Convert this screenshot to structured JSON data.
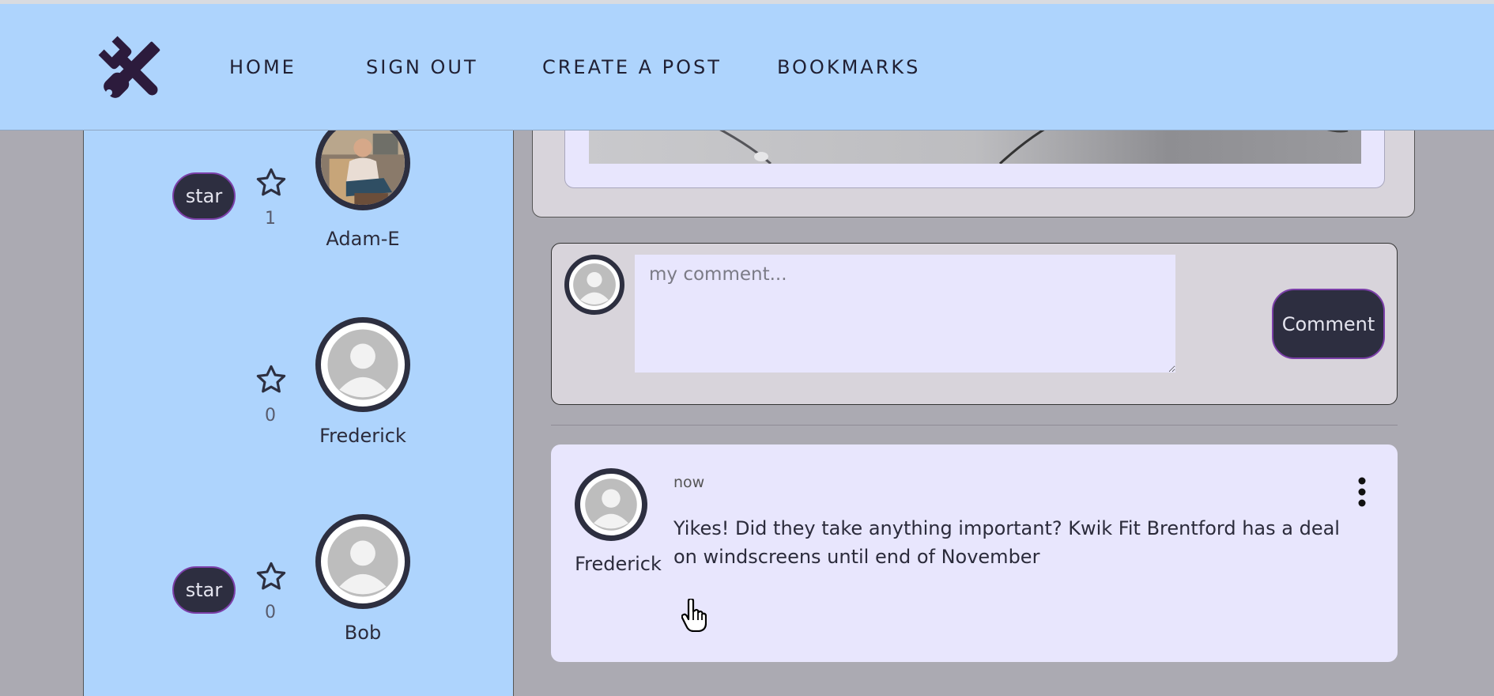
{
  "navbar": {
    "logo_icon": "tools-icon",
    "links": [
      "HOME",
      "SIGN OUT",
      "CREATE A POST",
      "BOOKMARKS"
    ]
  },
  "sidebar": {
    "profiles": [
      {
        "name": "Adam-E",
        "star_count": "1",
        "star_button": "star",
        "avatar": "photo"
      },
      {
        "name": "Frederick",
        "star_count": "0",
        "star_button": null,
        "avatar": "default"
      },
      {
        "name": "Bob",
        "star_count": "0",
        "star_button": "star",
        "avatar": "default"
      }
    ]
  },
  "comment_form": {
    "placeholder": "my comment...",
    "submit_label": "Comment"
  },
  "comments": [
    {
      "author": "Frederick",
      "time": "now",
      "text": "Yikes! Did they take anything important? Kwik Fit Brentford has a deal on windscreens until end of November"
    }
  ],
  "colors": {
    "navbar_bg": "#aed4fd",
    "page_bg": "#abaab2",
    "card_bg": "#d8d4db",
    "comment_bg": "#e8e6fd",
    "button_bg": "#2d2e40",
    "button_border": "#7b3fa8"
  }
}
